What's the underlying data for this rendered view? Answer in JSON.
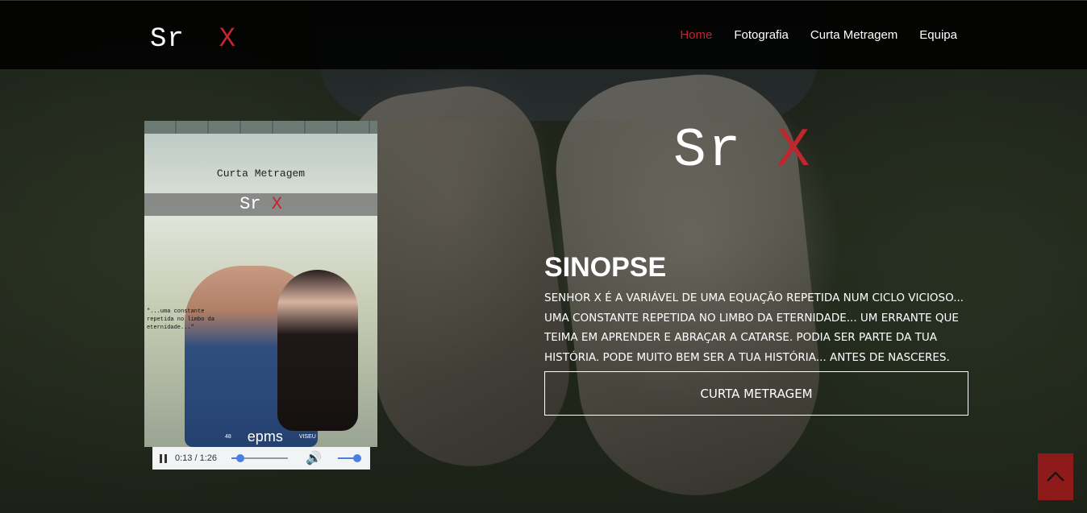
{
  "brand": {
    "text": "Sr",
    "x": "X"
  },
  "nav": {
    "items": [
      {
        "label": "Home",
        "active": true
      },
      {
        "label": "Fotografia",
        "active": false
      },
      {
        "label": "Curta Metragem",
        "active": false
      },
      {
        "label": "Equipa",
        "active": false
      }
    ]
  },
  "poster": {
    "subtitle": "Curta Metragem",
    "title": "Sr",
    "title_x": "X",
    "quote": "\"...uma constante repetida no limbo da eternidade...\"",
    "logos": [
      "48",
      "epms",
      "VISEU"
    ]
  },
  "player": {
    "current": "0:13",
    "duration": "1:26",
    "time_display": "0:13 / 1:26",
    "progress": 0.15,
    "volume": 1.0,
    "icons": {
      "play_pause": "pause-icon",
      "volume": "volume-icon"
    }
  },
  "hero": {
    "title": "Sr",
    "title_x": "X",
    "heading": "SINOPSE",
    "text": "SENHOR X É A VARIÁVEL DE UMA EQUAÇÃO REPETIDA NUM CICLO VICIOSO... UMA CONSTANTE REPETIDA NO LIMBO DA ETERNIDADE... UM ERRANTE QUE TEIMA EM APRENDER E ABRAÇAR A CATARSE. PODIA SER PARTE DA TUA HISTÓRIA. PODE MUITO BEM SER A TUA HISTÓRIA... ANTES DE NASCERES.",
    "button": "CURTA METRAGEM"
  },
  "to_top": {
    "icon": "chevron-up-icon"
  },
  "colors": {
    "accent": "#c0262d",
    "to_top_bg": "#8e1a1a",
    "player_accent": "#4a7fe0"
  }
}
